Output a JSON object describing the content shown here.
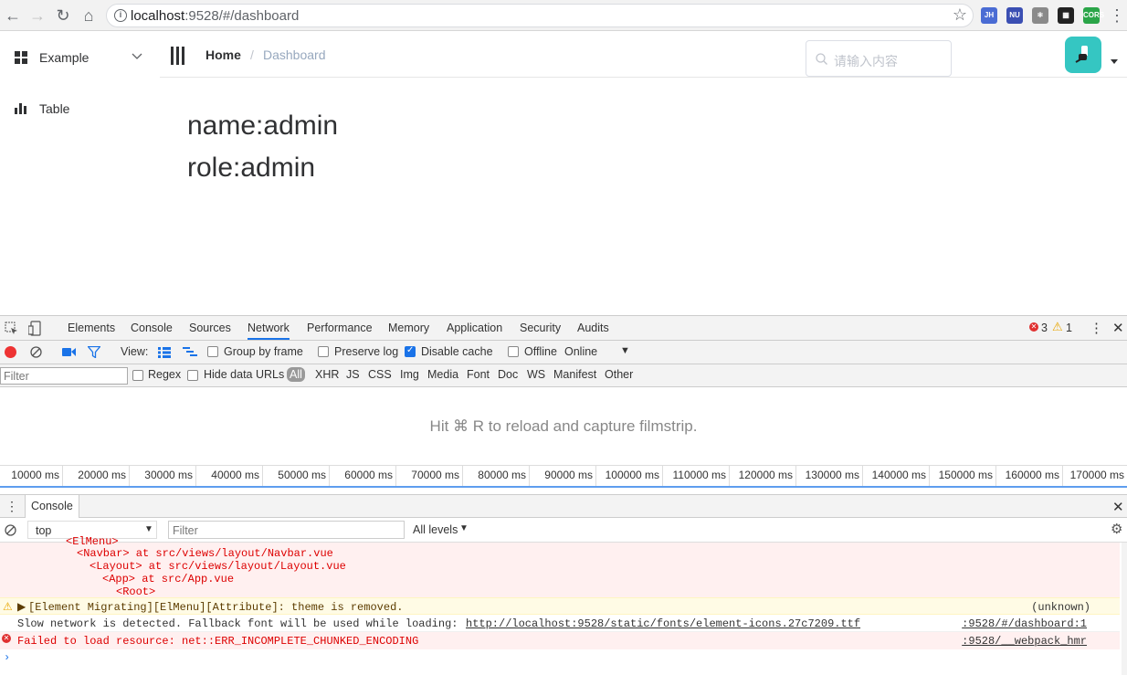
{
  "browser": {
    "url_host": "localhost",
    "url_rest": ":9528/#/dashboard",
    "extensions": [
      {
        "name": "jh-extension-icon",
        "label": "JH",
        "color": "#4a6cd4"
      },
      {
        "name": "nuxt-extension-icon",
        "label": "NU",
        "color": "#3b4fb3"
      },
      {
        "name": "react-devtools-icon",
        "label": "⚛",
        "color": "#8a8a8a"
      },
      {
        "name": "qr-code-icon",
        "label": "▦",
        "color": "#222222"
      },
      {
        "name": "cors-extension-icon",
        "label": "CORS",
        "color": "#2aa548"
      }
    ]
  },
  "sidebar": {
    "items": [
      {
        "label": "Example"
      },
      {
        "label": "Table"
      }
    ]
  },
  "navbar": {
    "breadcrumb_home": "Home",
    "breadcrumb_sep": "/",
    "breadcrumb_current": "Dashboard",
    "search_placeholder": "请输入内容"
  },
  "dashboard": {
    "name_line": "name:admin",
    "role_line": "role:admin"
  },
  "devtools": {
    "tabs": [
      "Elements",
      "Console",
      "Sources",
      "Network",
      "Performance",
      "Memory",
      "Application",
      "Security",
      "Audits"
    ],
    "active_tab": "Network",
    "error_count": "3",
    "warning_count": "1",
    "toolbar": {
      "view_label": "View:",
      "group_by_frame": "Group by frame",
      "preserve_log": "Preserve log",
      "disable_cache": "Disable cache",
      "offline": "Offline",
      "throttle": "Online"
    },
    "filterbar": {
      "filter_placeholder": "Filter",
      "regex": "Regex",
      "hide_data_urls": "Hide data URLs",
      "types": [
        "All",
        "XHR",
        "JS",
        "CSS",
        "Img",
        "Media",
        "Font",
        "Doc",
        "WS",
        "Manifest",
        "Other"
      ]
    },
    "filmstrip_message": "Hit ⌘ R to reload and capture filmstrip.",
    "timeline_ticks": [
      "10000 ms",
      "20000 ms",
      "30000 ms",
      "40000 ms",
      "50000 ms",
      "60000 ms",
      "70000 ms",
      "80000 ms",
      "90000 ms",
      "100000 ms",
      "110000 ms",
      "120000 ms",
      "130000 ms",
      "140000 ms",
      "150000 ms",
      "160000 ms",
      "170000 ms"
    ],
    "console_drawer": {
      "tab": "Console",
      "context": "top",
      "filter_placeholder": "Filter",
      "levels": "All levels"
    },
    "log": {
      "trace_lines": [
        "<ElMenu>",
        "<Navbar> at src/views/layout/Navbar.vue",
        "<Layout> at src/views/layout/Layout.vue",
        "<App> at src/App.vue",
        "<Root>"
      ],
      "warning": "[Element Migrating][ElMenu][Attribute]: theme is removed.",
      "warning_source": "(unknown)",
      "info_prefix": "Slow network is detected. Fallback font will be used while loading: ",
      "info_link": "http://localhost:9528/static/fonts/element-icons.27c7209.ttf",
      "info_source": ":9528/#/dashboard:1",
      "error": "Failed to load resource: net::ERR_INCOMPLETE_CHUNKED_ENCODING",
      "error_source": ":9528/__webpack_hmr"
    }
  }
}
